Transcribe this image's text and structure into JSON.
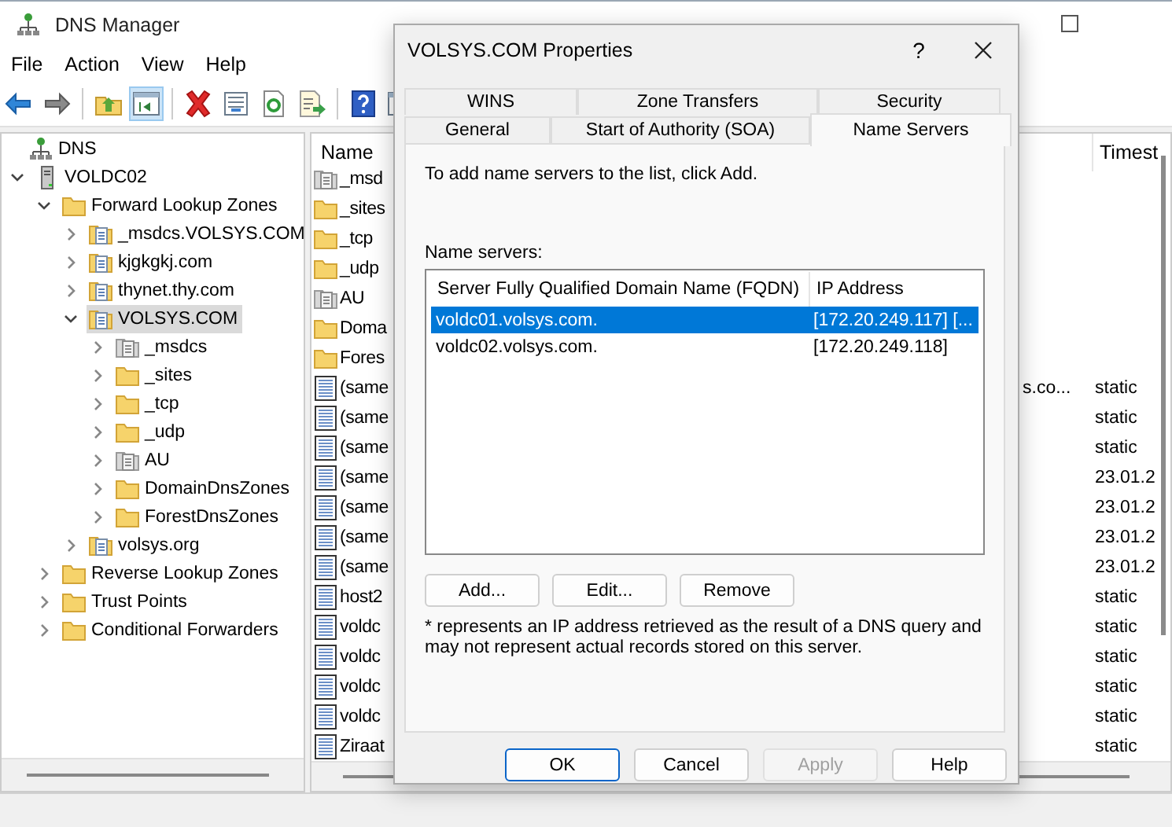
{
  "window": {
    "title": "DNS Manager"
  },
  "menu": [
    "File",
    "Action",
    "View",
    "Help"
  ],
  "toolbar_groups": [
    {
      "buttons": [
        {
          "kind": "back",
          "pressed": false
        },
        {
          "kind": "forward",
          "pressed": false
        }
      ]
    },
    {
      "buttons": [
        {
          "kind": "up",
          "pressed": false
        },
        {
          "kind": "tree",
          "pressed": true
        }
      ]
    },
    {
      "buttons": [
        {
          "kind": "delete",
          "pressed": false
        },
        {
          "kind": "properties",
          "pressed": false
        },
        {
          "kind": "refresh",
          "pressed": false
        },
        {
          "kind": "export",
          "pressed": false
        }
      ]
    },
    {
      "buttons": [
        {
          "kind": "help",
          "pressed": false
        },
        {
          "kind": "pane",
          "pressed": false
        }
      ]
    }
  ],
  "tree": {
    "root": {
      "label": "DNS"
    },
    "items": [
      {
        "label": "VOLDC02",
        "kind": "server",
        "expanded": true,
        "selected": false,
        "children": [
          {
            "label": "Forward Lookup Zones",
            "kind": "folder",
            "expanded": true,
            "selected": false,
            "children": [
              {
                "label": "_msdcs.VOLSYS.COM",
                "kind": "zone",
                "expanded": false,
                "selected": false
              },
              {
                "label": "kjgkgkj.com",
                "kind": "zone",
                "expanded": false,
                "selected": false
              },
              {
                "label": "thynet.thy.com",
                "kind": "zone",
                "expanded": false,
                "selected": false
              },
              {
                "label": "VOLSYS.COM",
                "kind": "zone",
                "expanded": true,
                "selected": true,
                "children": [
                  {
                    "label": "_msdcs",
                    "kind": "delegation",
                    "expanded": false,
                    "selected": false
                  },
                  {
                    "label": "_sites",
                    "kind": "folder",
                    "expanded": false,
                    "selected": false
                  },
                  {
                    "label": "_tcp",
                    "kind": "folder",
                    "expanded": false,
                    "selected": false
                  },
                  {
                    "label": "_udp",
                    "kind": "folder",
                    "expanded": false,
                    "selected": false
                  },
                  {
                    "label": "AU",
                    "kind": "delegation",
                    "expanded": false,
                    "selected": false
                  },
                  {
                    "label": "DomainDnsZones",
                    "kind": "folder",
                    "expanded": false,
                    "selected": false
                  },
                  {
                    "label": "ForestDnsZones",
                    "kind": "folder",
                    "expanded": false,
                    "selected": false
                  }
                ]
              },
              {
                "label": "volsys.org",
                "kind": "zone",
                "expanded": false,
                "selected": false
              }
            ]
          },
          {
            "label": "Reverse Lookup Zones",
            "kind": "folder",
            "expanded": false,
            "selected": false
          },
          {
            "label": "Trust Points",
            "kind": "folder",
            "expanded": false,
            "selected": false
          },
          {
            "label": "Conditional Forwarders",
            "kind": "folder",
            "expanded": false,
            "selected": false
          }
        ]
      }
    ]
  },
  "list": {
    "columns": [
      "Name",
      "Timest"
    ],
    "rows": [
      {
        "kind": "delegation",
        "name": "_msd"
      },
      {
        "kind": "folder",
        "name": "_sites"
      },
      {
        "kind": "folder",
        "name": "_tcp"
      },
      {
        "kind": "folder",
        "name": "_udp"
      },
      {
        "kind": "delegation",
        "name": "AU"
      },
      {
        "kind": "folder",
        "name": "Doma"
      },
      {
        "kind": "folder",
        "name": "Fores"
      },
      {
        "kind": "record",
        "name": "(same",
        "data": "s.co...",
        "timestamp": "static"
      },
      {
        "kind": "record",
        "name": "(same",
        "timestamp": "static"
      },
      {
        "kind": "record",
        "name": "(same",
        "timestamp": "static"
      },
      {
        "kind": "record",
        "name": "(same",
        "timestamp": "23.01.2"
      },
      {
        "kind": "record",
        "name": "(same",
        "timestamp": "23.01.2"
      },
      {
        "kind": "record",
        "name": "(same",
        "timestamp": "23.01.2"
      },
      {
        "kind": "record",
        "name": "(same",
        "timestamp": "23.01.2"
      },
      {
        "kind": "record",
        "name": "host2",
        "timestamp": "static"
      },
      {
        "kind": "record",
        "name": "voldc",
        "timestamp": "static"
      },
      {
        "kind": "record",
        "name": "voldc",
        "timestamp": "static"
      },
      {
        "kind": "record",
        "name": "voldc",
        "timestamp": "static"
      },
      {
        "kind": "record",
        "name": "voldc",
        "timestamp": "static"
      },
      {
        "kind": "record",
        "name": "Ziraat",
        "timestamp": "static"
      }
    ]
  },
  "dialog": {
    "title": "VOLSYS.COM Properties",
    "help": "?",
    "tab_rows": [
      {
        "tabs": [
          {
            "label": "WINS",
            "selected": false
          },
          {
            "label": "Zone Transfers",
            "selected": false
          },
          {
            "label": "Security",
            "selected": false
          }
        ]
      },
      {
        "tabs": [
          {
            "label": "General",
            "selected": false
          },
          {
            "label": "Start of Authority (SOA)",
            "selected": false
          },
          {
            "label": "Name Servers",
            "selected": true
          }
        ]
      }
    ],
    "instruction": "To add name servers to the list, click Add.",
    "name_servers": {
      "label": "Name servers:",
      "columns": [
        "Server Fully Qualified Domain Name (FQDN)",
        "IP Address"
      ],
      "rows": [
        {
          "fqdn": "voldc01.volsys.com.",
          "ip": "[172.20.249.117] [...",
          "selected": true
        },
        {
          "fqdn": "voldc02.volsys.com.",
          "ip": "[172.20.249.118]",
          "selected": false
        }
      ]
    },
    "list_buttons": [
      "Add...",
      "Edit...",
      "Remove"
    ],
    "note": "* represents an IP address retrieved as the result of a DNS query and may not represent actual records stored on this server.",
    "buttons": [
      {
        "label": "OK",
        "default": true,
        "disabled": false
      },
      {
        "label": "Cancel",
        "default": false,
        "disabled": false
      },
      {
        "label": "Apply",
        "default": false,
        "disabled": true
      },
      {
        "label": "Help",
        "default": false,
        "disabled": false
      }
    ]
  }
}
